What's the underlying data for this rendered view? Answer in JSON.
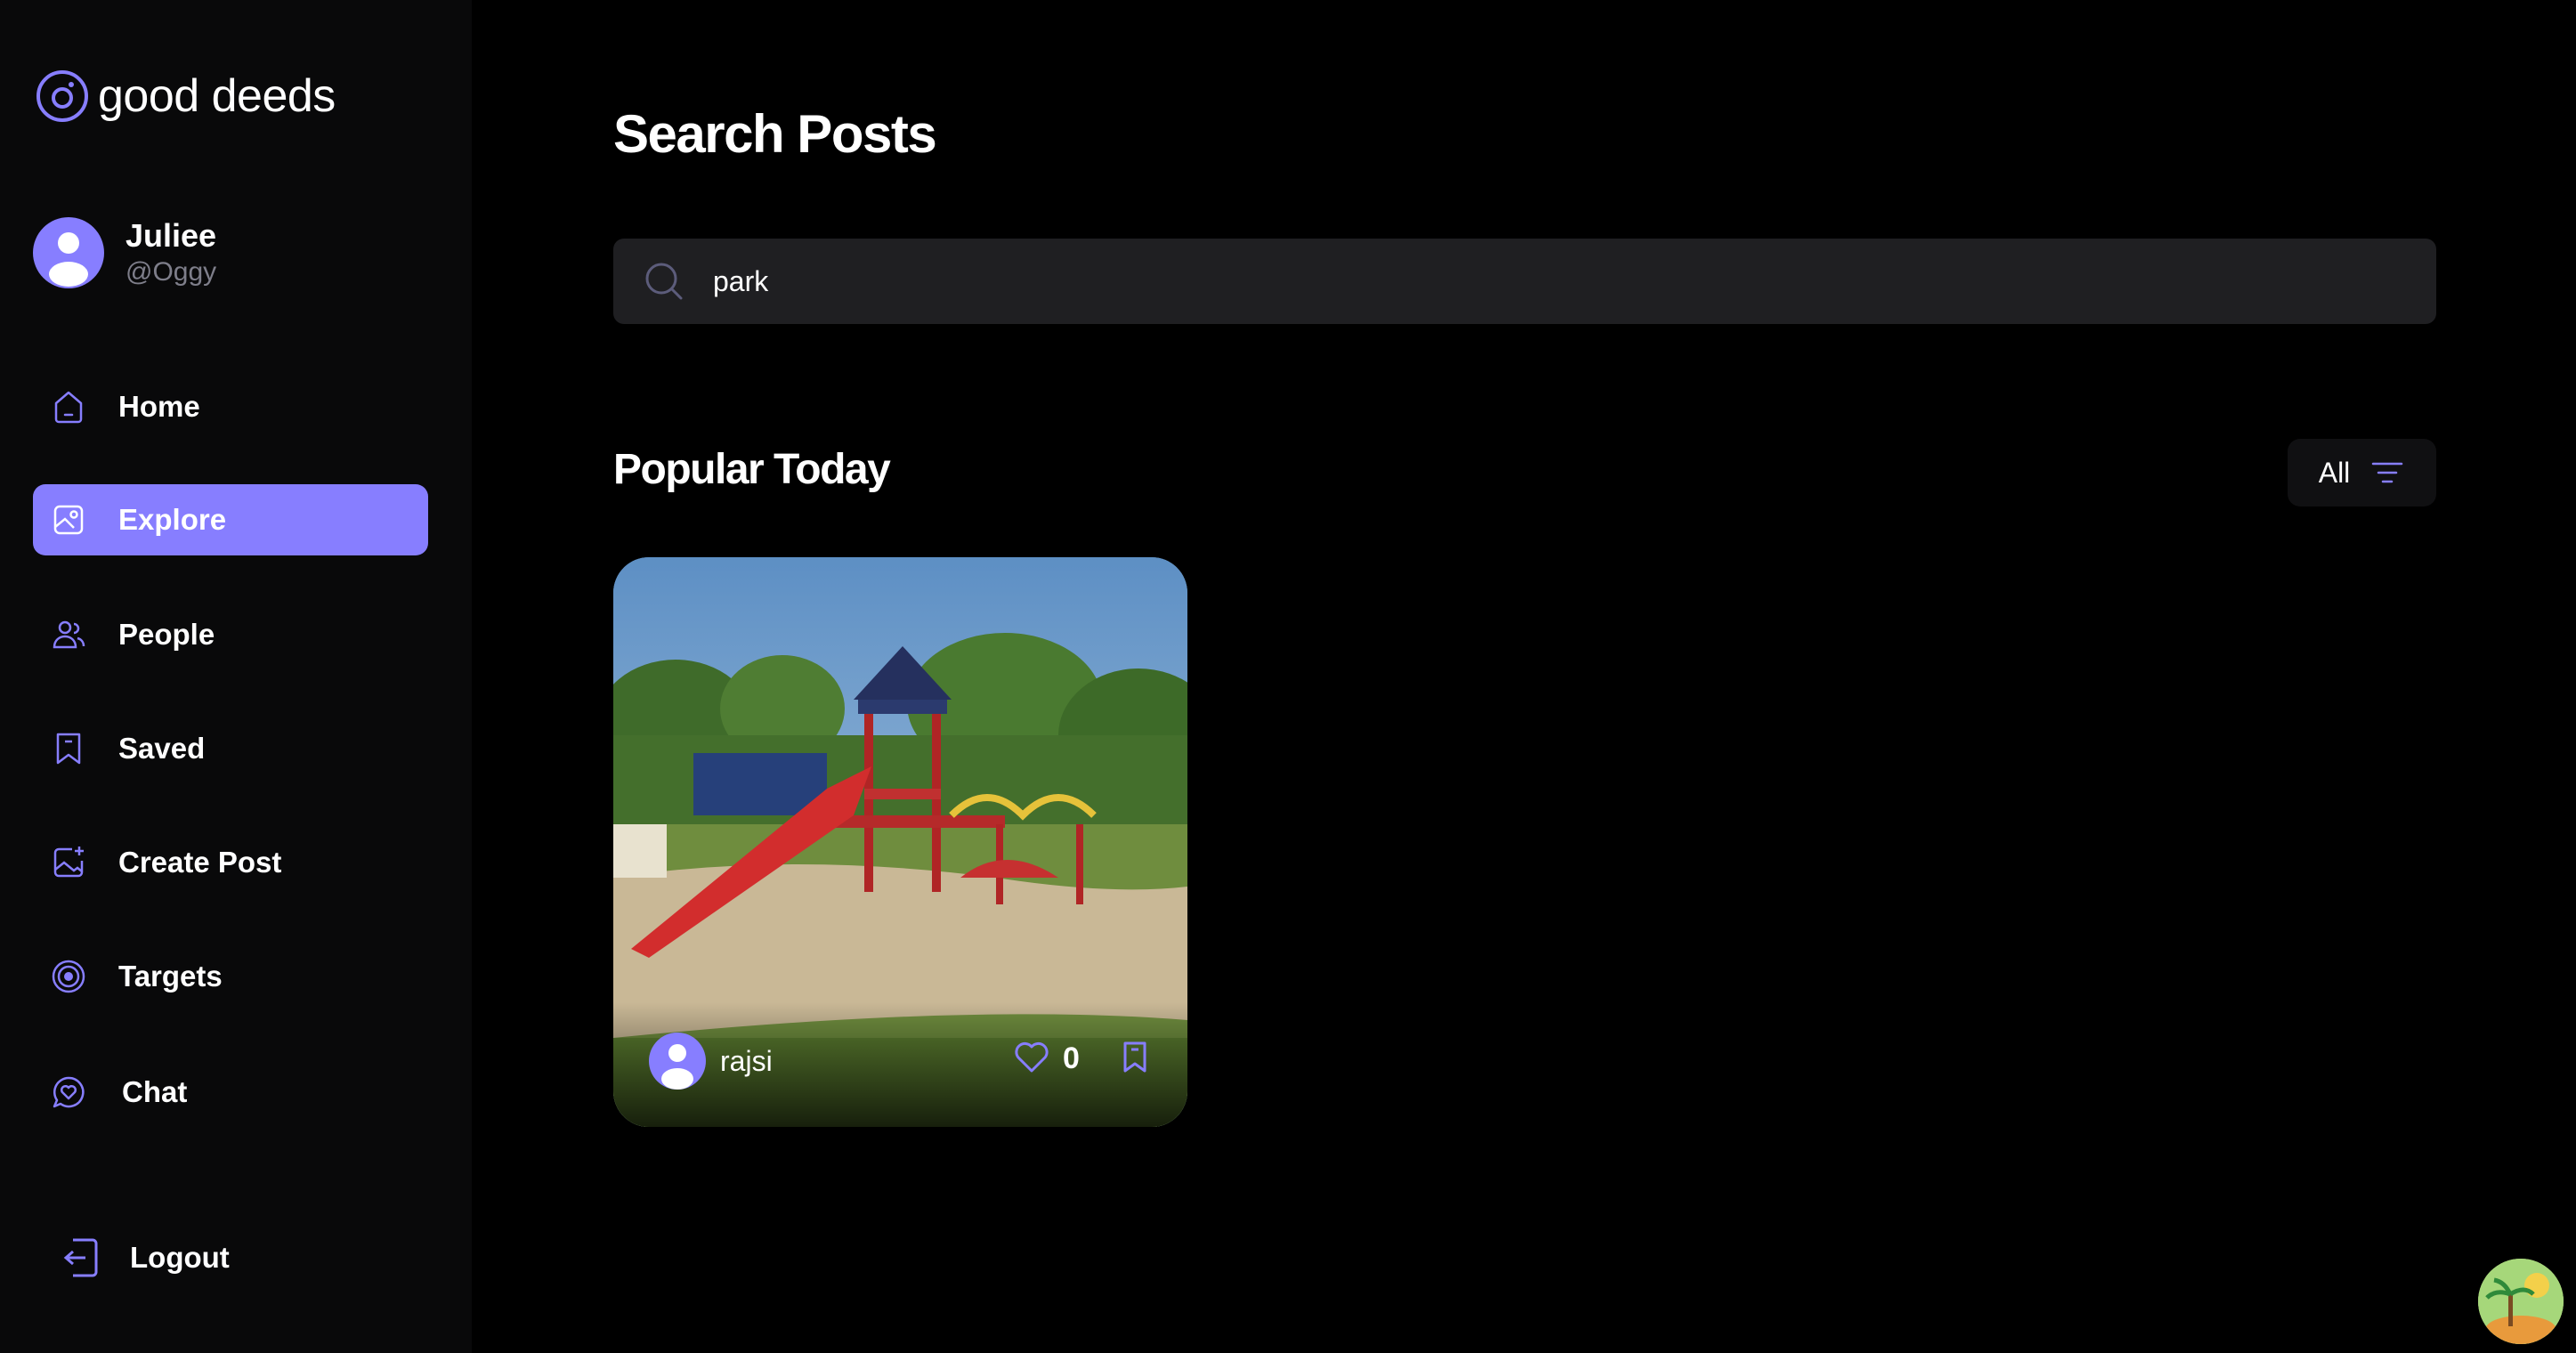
{
  "brand": {
    "name": "good deeds"
  },
  "user": {
    "name": "Juliee",
    "handle": "@Oggy"
  },
  "nav": {
    "items": [
      {
        "label": "Home",
        "icon": "home-icon"
      },
      {
        "label": "Explore",
        "icon": "explore-icon",
        "active": true
      },
      {
        "label": "People",
        "icon": "people-icon"
      },
      {
        "label": "Saved",
        "icon": "bookmark-icon"
      },
      {
        "label": "Create Post",
        "icon": "image-add-icon"
      },
      {
        "label": "Targets",
        "icon": "target-icon"
      },
      {
        "label": "Chat",
        "icon": "chat-heart-icon"
      }
    ],
    "logout_label": "Logout"
  },
  "main": {
    "title": "Search Posts",
    "search": {
      "value": "park",
      "placeholder": "Search"
    },
    "section_title": "Popular Today",
    "filter_label": "All",
    "posts": [
      {
        "author": "rajsi",
        "likes": "0",
        "image": "playground-photo"
      }
    ]
  },
  "colors": {
    "accent": "#877eff",
    "sidebar_bg": "#09090a",
    "page_bg": "#000000",
    "input_bg": "#1f1f22",
    "muted_text": "#7e7e8a"
  }
}
